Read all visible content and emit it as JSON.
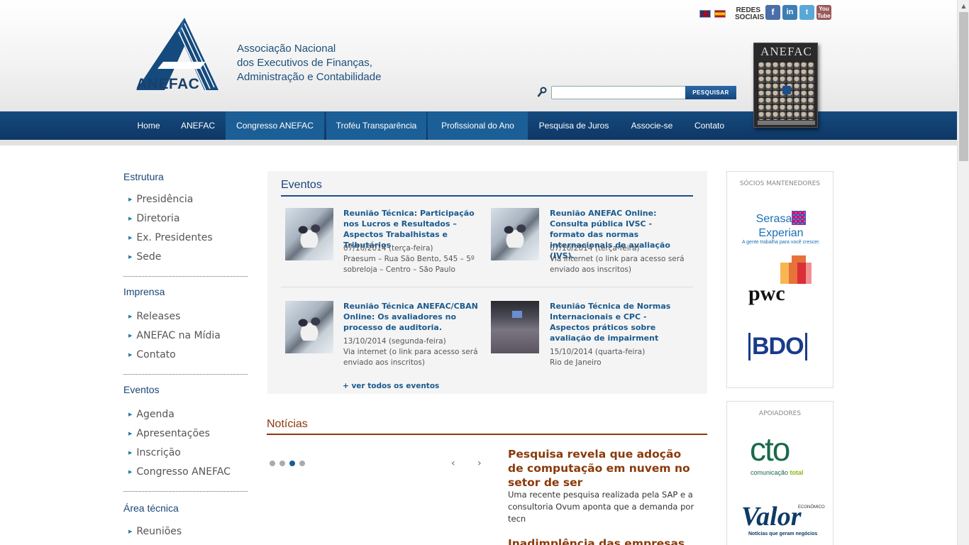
{
  "header": {
    "logo_text": "ANEFAC",
    "tagline": [
      "Associação Nacional",
      "dos Executivos de Finanças,",
      "Administração e Contabilidade"
    ],
    "redes_sociais": [
      "REDES",
      "SOCIAIS"
    ],
    "social": {
      "facebook": "f",
      "linkedin": "in",
      "twitter": "t",
      "youtube": "You Tube"
    },
    "search_button": "PESQUISAR",
    "magazine_title": "ANEFAC"
  },
  "nav": {
    "items": [
      {
        "label": "Home"
      },
      {
        "label": "ANEFAC"
      },
      {
        "label": "Congresso ANEFAC"
      },
      {
        "label": "Troféu Transparência"
      },
      {
        "label": "Profissional do Ano"
      },
      {
        "label": "Pesquisa de Juros"
      },
      {
        "label": "Associe-se"
      },
      {
        "label": "Contato"
      }
    ]
  },
  "sidebar": {
    "sections": [
      {
        "title": "Estrutura",
        "links": [
          "Presidência",
          "Diretoria",
          "Ex. Presidentes",
          "Sede"
        ]
      },
      {
        "title": "Imprensa",
        "links": [
          "Releases",
          "ANEFAC na Mídia",
          "Contato"
        ]
      },
      {
        "title": "Eventos",
        "links": [
          "Agenda",
          "Apresentações",
          "Inscrição",
          "Congresso ANEFAC"
        ]
      },
      {
        "title": "Área técnica",
        "links": [
          "Reuniões"
        ]
      }
    ]
  },
  "eventos": {
    "title": "Eventos",
    "items": [
      {
        "title": "Reunião Técnica: Participação nos Lucros e Resultados – Aspectos Trabalhistas e Tributários",
        "date": "07/10/2014 (terça-feira)",
        "place": "Praesum – Rua São Bento, 545 – 5º sobreloja – Centro – São Paulo"
      },
      {
        "title": "Reunião ANEFAC Online: Consulta pública IVSC - formato das normas internacionais de avaliação (IVS).",
        "date": "07/10/2014 (terça-feira)",
        "place": "Via internet (o link para acesso será enviado aos inscritos)"
      },
      {
        "title": "Reunião Técnica ANEFAC/CBAN Online: Os avaliadores no processo de auditoria.",
        "date": "13/10/2014 (segunda-feira)",
        "place": "Via internet (o link para acesso será enviado aos inscritos)"
      },
      {
        "title": "Reunião Técnica de Normas Internacionais e CPC - Aspectos práticos sobre avaliação de impairment",
        "date": "15/10/2014 (quarta-feira)",
        "place": "Rio de Janeiro"
      }
    ],
    "see_all": "+ ver todos os eventos"
  },
  "noticias": {
    "title": "Notícias",
    "carousel": {
      "active_index": 2,
      "count": 4
    },
    "headline": "Pesquisa revela que adoção de computação em nuvem no setor de ser",
    "body": "Uma recente pesquisa realizada pela SAP e a consultoria Ovum aponta que a demanda por tecn",
    "next_headline": "Inadimplência das empresas"
  },
  "sponsors": {
    "mantenedores_title": "SÓCIOS MANTENEDORES",
    "serasa": {
      "name_left": "Serasa",
      "name_right": "Experian",
      "tagline": "A gente trabalha para você crescer."
    },
    "pwc": "pwc",
    "bdo": "BDO",
    "apoiadores_title": "APOIADORES",
    "cto": {
      "name": "cto",
      "sub_left": "comunicação",
      "sub_right": "total"
    },
    "valor": {
      "name": "Valor",
      "eco": "ECONÔMICO",
      "tagline": "Notícias que geram negócios"
    }
  },
  "colors": {
    "brand_blue": "#154a7e",
    "news_brown": "#8a3a0a",
    "link_blue": "#1a5a8e"
  }
}
